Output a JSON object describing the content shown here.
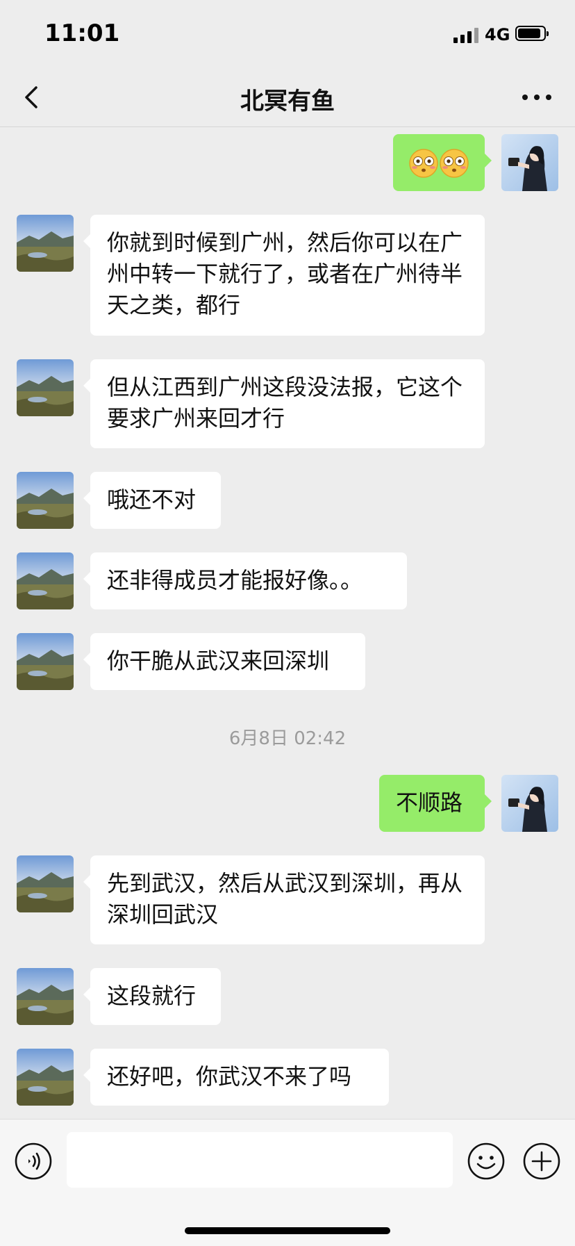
{
  "status": {
    "time": "11:01",
    "network": "4G"
  },
  "nav": {
    "title": "北冥有鱼",
    "back_icon": "chevron-left-icon",
    "more_icon": "more-dots-icon"
  },
  "messages": [
    {
      "from": "me",
      "text": "",
      "emoji": [
        "flushed-face",
        "flushed-face"
      ]
    },
    {
      "from": "other",
      "text": "你就到时候到广州，然后你可以在广州中转一下就行了，或者在广州待半天之类，都行"
    },
    {
      "from": "other",
      "text": "但从江西到广州这段没法报，它这个要求广州来回才行"
    },
    {
      "from": "other",
      "text": "哦还不对"
    },
    {
      "from": "other",
      "text": "还非得成员才能报好像。。"
    },
    {
      "from": "other",
      "text": "你干脆从武汉来回深圳"
    },
    {
      "from": "me",
      "text": "不顺路"
    },
    {
      "from": "other",
      "text": "先到武汉，然后从武汉到深圳，再从深圳回武汉"
    },
    {
      "from": "other",
      "text": "这段就行"
    },
    {
      "from": "other",
      "text": "还好吧，你武汉不来了吗"
    }
  ],
  "timestamp": "6月8日 02:42",
  "input": {
    "value": "",
    "placeholder": ""
  },
  "colors": {
    "background": "#ededed",
    "bubble_out": "#95ec69",
    "bubble_in": "#ffffff"
  }
}
